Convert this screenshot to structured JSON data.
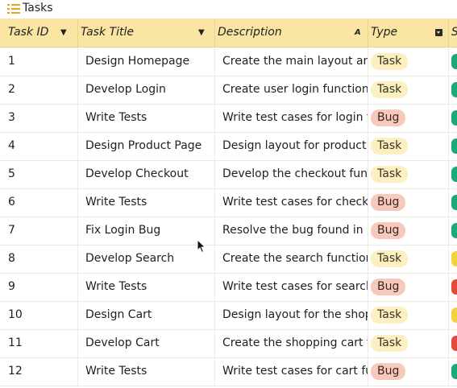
{
  "window": {
    "title": "Tasks"
  },
  "colors": {
    "header_bg": "#fbe5a3",
    "task_badge": "#fcefc0",
    "bug_badge": "#f7c9bd",
    "status_green": "#1aaa7a",
    "status_yellow": "#f0d43a",
    "status_red": "#e24b3b"
  },
  "columns": [
    {
      "label": "Task ID"
    },
    {
      "label": "Task Title"
    },
    {
      "label": "Description"
    },
    {
      "label": "Type"
    },
    {
      "label": "S"
    }
  ],
  "rows": [
    {
      "id": "1",
      "title": "Design Homepage",
      "description": "Create the main layout and visual design",
      "type": "Task",
      "status": "green"
    },
    {
      "id": "2",
      "title": "Develop Login",
      "description": "Create user login functionality",
      "type": "Task",
      "status": "green"
    },
    {
      "id": "3",
      "title": "Write Tests",
      "description": "Write test cases for login functionality",
      "type": "Bug",
      "status": "green"
    },
    {
      "id": "4",
      "title": "Design Product Page",
      "description": "Design layout for product display",
      "type": "Task",
      "status": "green"
    },
    {
      "id": "5",
      "title": "Develop Checkout",
      "description": "Develop the checkout functionality",
      "type": "Task",
      "status": "green"
    },
    {
      "id": "6",
      "title": "Write Tests",
      "description": "Write test cases for checkout",
      "type": "Bug",
      "status": "green"
    },
    {
      "id": "7",
      "title": "Fix Login Bug",
      "description": "Resolve the bug found in login",
      "type": "Bug",
      "status": "green"
    },
    {
      "id": "8",
      "title": "Develop Search",
      "description": "Create the search functionality",
      "type": "Task",
      "status": "yellow"
    },
    {
      "id": "9",
      "title": "Write Tests",
      "description": "Write test cases for search functionality",
      "type": "Bug",
      "status": "red"
    },
    {
      "id": "10",
      "title": "Design Cart",
      "description": "Design layout for the shopping cart",
      "type": "Task",
      "status": "yellow"
    },
    {
      "id": "11",
      "title": "Develop Cart",
      "description": "Create the shopping cart functionality",
      "type": "Task",
      "status": "red"
    },
    {
      "id": "12",
      "title": "Write Tests",
      "description": "Write test cases for cart functionality",
      "type": "Bug",
      "status": "green"
    }
  ]
}
